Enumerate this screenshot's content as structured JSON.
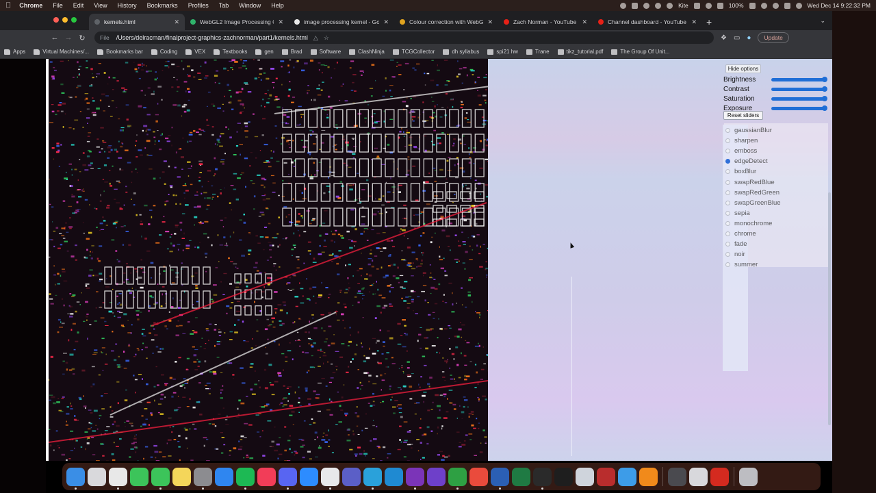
{
  "menubar": {
    "items": [
      "Chrome",
      "File",
      "Edit",
      "View",
      "History",
      "Bookmarks",
      "Profiles",
      "Tab",
      "Window",
      "Help"
    ],
    "kite_label": "Kite",
    "battery": "100%",
    "datetime": "Wed Dec 14  9:22:32 PM"
  },
  "tabs": [
    {
      "label": "kernels.html",
      "active": true,
      "color": "#5f6368"
    },
    {
      "label": "WebGL2 Image Processing Co",
      "active": false,
      "color": "#2fb36b"
    },
    {
      "label": "image processing kernel - Go",
      "active": false,
      "color": "#e8e8e8"
    },
    {
      "label": "Colour correction with WebG",
      "active": false,
      "color": "#e0a31f"
    },
    {
      "label": "Zach Norman - YouTube",
      "active": false,
      "color": "#e62117"
    },
    {
      "label": "Channel dashboard - YouTube",
      "active": false,
      "color": "#e62117"
    }
  ],
  "address": {
    "scheme": "File",
    "url": "/Users/delracman/finalproject-graphics-zachnorman/part1/kernels.html",
    "update_label": "Update"
  },
  "bookmarks": [
    "Apps",
    "Virtual Machines/...",
    "Bookmarks bar",
    "Coding",
    "VEX",
    "Textbooks",
    "gen",
    "Brad",
    "Software",
    "ClashNinja",
    "TCGCollector",
    "dh syllabus",
    "spi21 hw",
    "Trane",
    "tikz_tutorial.pdf",
    "The Group Of Unit..."
  ],
  "controls": {
    "hide_options_label": "Hide options",
    "sliders": [
      {
        "label": "Brightness",
        "value": 1.0
      },
      {
        "label": "Contrast",
        "value": 1.0
      },
      {
        "label": "Saturation",
        "value": 1.0
      },
      {
        "label": "Exposure",
        "value": 1.0
      }
    ],
    "reset_label": "Reset sliders",
    "kernels": [
      "gaussianBlur",
      "sharpen",
      "emboss",
      "edgeDetect",
      "boxBlur",
      "swapRedBlue",
      "swapRedGreen",
      "swapGreenBlue",
      "sepia",
      "monochrome",
      "chrome",
      "fade",
      "noir",
      "summer"
    ],
    "selected_kernel": "edgeDetect"
  },
  "dock": {
    "apps": [
      {
        "name": "finder-icon",
        "color": "#3a8ee6"
      },
      {
        "name": "launchpad-icon",
        "color": "#d9d9dc"
      },
      {
        "name": "chrome-icon",
        "color": "#e8e8e8"
      },
      {
        "name": "facetime-icon",
        "color": "#3cc45a"
      },
      {
        "name": "messages-icon",
        "color": "#3cc45a"
      },
      {
        "name": "notes-icon",
        "color": "#f4d65a"
      },
      {
        "name": "system-preferences-icon",
        "color": "#8c8c90"
      },
      {
        "name": "app-store-icon",
        "color": "#2f86f0"
      },
      {
        "name": "spotify-icon",
        "color": "#1db954"
      },
      {
        "name": "music-icon",
        "color": "#f23d58"
      },
      {
        "name": "discord-icon",
        "color": "#5865f2"
      },
      {
        "name": "zoom-icon",
        "color": "#2d8cff"
      },
      {
        "name": "slack-icon",
        "color": "#e8e8ea"
      },
      {
        "name": "teams-icon",
        "color": "#5b5fc7"
      },
      {
        "name": "telegram-icon",
        "color": "#2aa1da"
      },
      {
        "name": "vscode-icon",
        "color": "#1f8ad2"
      },
      {
        "name": "onenote-icon",
        "color": "#7b34b8"
      },
      {
        "name": "github-icon",
        "color": "#6e40c9"
      },
      {
        "name": "loader-icon",
        "color": "#2ea043"
      },
      {
        "name": "creative-cloud-icon",
        "color": "#ea4b3c"
      },
      {
        "name": "word-icon",
        "color": "#2b5fb4"
      },
      {
        "name": "excel-icon",
        "color": "#1f7a43"
      },
      {
        "name": "figma-icon",
        "color": "#2a2a2a"
      },
      {
        "name": "terminal-icon",
        "color": "#1e1e1e"
      },
      {
        "name": "preview-icon",
        "color": "#cfd4dc"
      },
      {
        "name": "mathematica-icon",
        "color": "#b92d2d"
      },
      {
        "name": "cloud-app-icon",
        "color": "#3d9ce8"
      },
      {
        "name": "vlc-icon",
        "color": "#f18a1b"
      },
      {
        "name": "screen-recorder-icon",
        "color": "#4a4a4f"
      },
      {
        "name": "printer-icon",
        "color": "#d8d8dc"
      },
      {
        "name": "acrobat-icon",
        "color": "#d42a1f"
      },
      {
        "name": "trash-icon",
        "color": "#bdbdc2"
      }
    ]
  }
}
